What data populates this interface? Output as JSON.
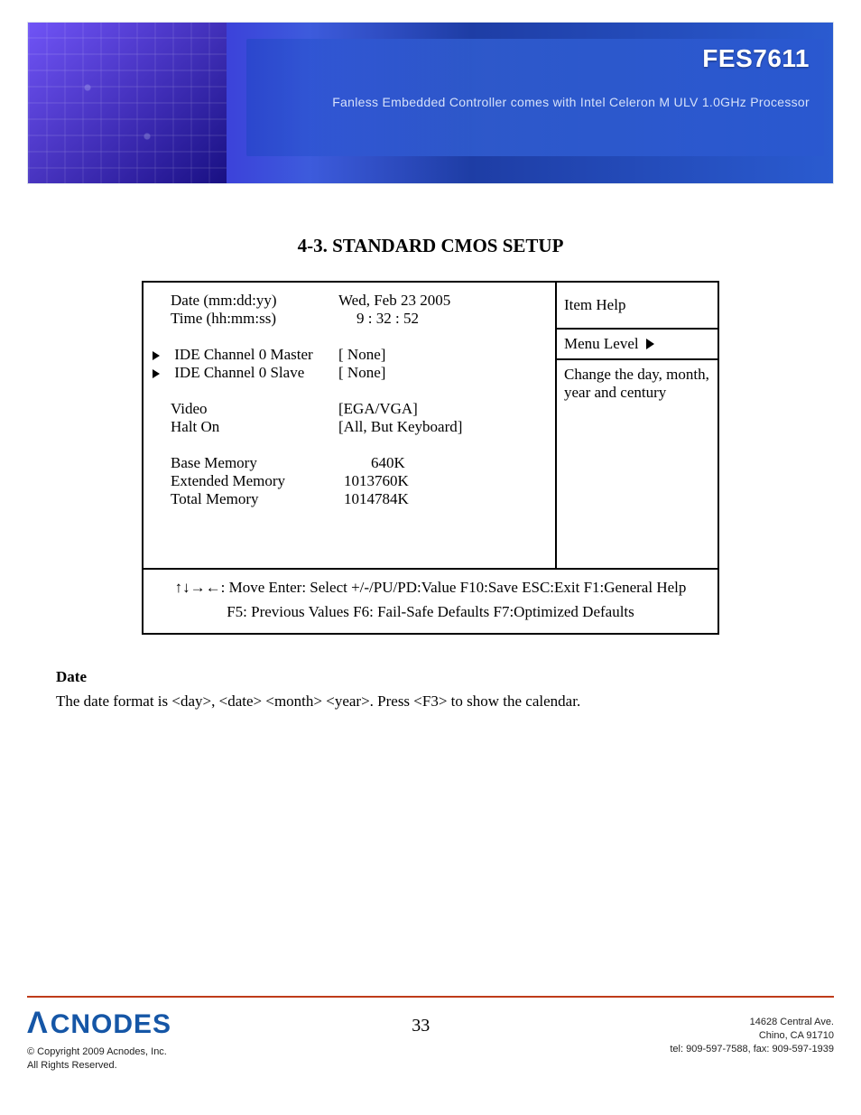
{
  "header": {
    "product": "FES7611",
    "subtitle": "Fanless Embedded Controller comes with Intel Celeron M ULV 1.0GHz Processor"
  },
  "section_title": "4-3. STANDARD CMOS SETUP",
  "bios": {
    "left": {
      "date_label": "Date (mm:dd:yy)",
      "date_value": "Wed, Feb   23   2005",
      "time_label": "Time (hh:mm:ss)",
      "time_value": "9   :   32 :   52",
      "ide_master_label": "IDE Channel 0 Master",
      "ide_master_value": "[ None]",
      "ide_slave_label": "IDE Channel 0 Slave",
      "ide_slave_value": "[ None]",
      "video_label": "Video",
      "video_value": "[EGA/VGA]",
      "halt_label": "Halt On",
      "halt_value": "[All, But Keyboard]",
      "base_mem_label": "Base Memory",
      "base_mem_value": "640K",
      "ext_mem_label": "Extended Memory",
      "ext_mem_value": "1013760K",
      "total_mem_label": "Total Memory",
      "total_mem_value": "1014784K"
    },
    "right": {
      "item_help": "Item Help",
      "menu_level": "Menu Level",
      "help_text": "Change the day, month, year and century"
    },
    "footer_line1": "↑↓→←: Move   Enter: Select   +/-/PU/PD:Value   F10:Save   ESC:Exit   F1:General Help",
    "footer_line2": "F5: Previous Values       F6: Fail-Safe Defaults     F7:Optimized Defaults"
  },
  "body": {
    "heading": "Date",
    "text": "The date format is <day>, <date> <month> <year>. Press <F3> to show the calendar."
  },
  "footer": {
    "brand": "CNODES",
    "copyright_l1": "© Copyright 2009 Acnodes, Inc.",
    "copyright_l2": "All Rights Reserved.",
    "page_number": "33",
    "address_l1": "14628 Central Ave.",
    "address_l2": "Chino, CA 91710",
    "contact": "tel: 909-597-7588, fax: 909-597-1939"
  }
}
